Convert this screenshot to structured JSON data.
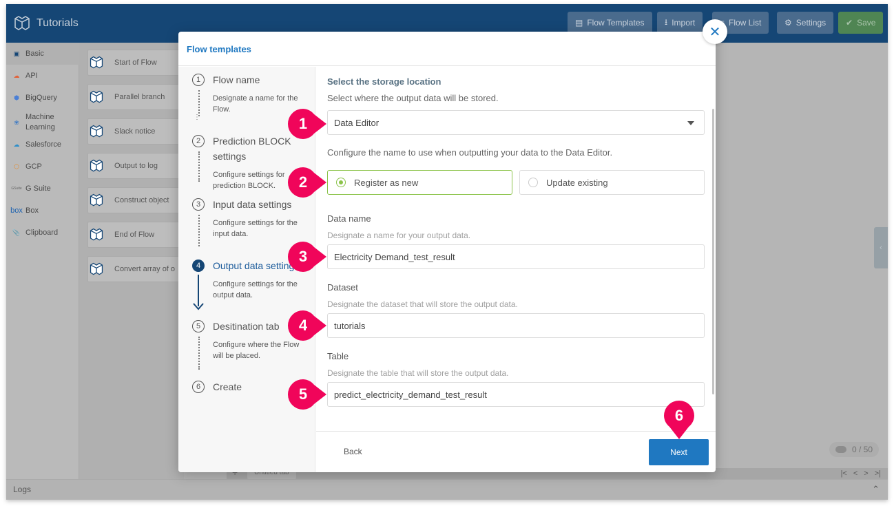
{
  "app": {
    "title": "Tutorials",
    "toolbar": [
      {
        "label": "Flow Templates",
        "icon": "list-icon"
      },
      {
        "label": "Import",
        "icon": "upload-icon"
      },
      {
        "label": "Flow List",
        "icon": "menu-icon"
      },
      {
        "label": "Settings",
        "icon": "gear-icon"
      },
      {
        "label": "Save",
        "icon": "check-circle-icon"
      }
    ]
  },
  "categories": [
    {
      "label": "Basic",
      "icon": "basic-block-icon",
      "active": true
    },
    {
      "label": "API",
      "icon": "api-cloud-icon"
    },
    {
      "label": "BigQuery",
      "icon": "bigquery-icon"
    },
    {
      "label": "Machine Learning",
      "icon": "brain-icon"
    },
    {
      "label": "Salesforce",
      "icon": "salesforce-cloud-icon"
    },
    {
      "label": "GCP",
      "icon": "gcp-icon"
    },
    {
      "label": "G Suite",
      "icon": "gsuite-icon",
      "icon_text": "G Suite"
    },
    {
      "label": "Box",
      "icon": "box-icon",
      "icon_text": "box"
    },
    {
      "label": "Clipboard",
      "icon": "paperclip-icon"
    }
  ],
  "blocks": [
    {
      "label": "Start of Flow"
    },
    {
      "label": "Parallel branch"
    },
    {
      "label": "Slack notice"
    },
    {
      "label": "Output to log"
    },
    {
      "label": "Construct object"
    },
    {
      "label": "End of Flow"
    },
    {
      "label": "Convert array of o"
    }
  ],
  "canvas": {
    "counter": "0 / 50",
    "tab_label": "Untitled tab",
    "pager": [
      "|<",
      "<",
      ">",
      ">|"
    ]
  },
  "logs": {
    "label": "Logs"
  },
  "modal": {
    "title": "Flow templates",
    "steps": [
      {
        "num": "1",
        "title": "Flow name",
        "desc": "Designate a name for the Flow."
      },
      {
        "num": "2",
        "title": "Prediction BLOCK settings",
        "desc": "Configure settings for prediction BLOCK."
      },
      {
        "num": "3",
        "title": "Input data settings",
        "desc": "Configure settings for the input data."
      },
      {
        "num": "4",
        "title": "Output data settings",
        "desc": "Configure settings for the output data.",
        "active": true
      },
      {
        "num": "5",
        "title": "Desitination tab",
        "desc": "Configure where the Flow will be placed."
      },
      {
        "num": "6",
        "title": "Create",
        "desc": ""
      }
    ],
    "content": {
      "section_title": "Select the storage location",
      "section_desc": "Select where the output data will be stored.",
      "storage_select": "Data Editor",
      "name_desc": "Configure the name to use when outputting your data to the Data Editor.",
      "radio_options": [
        {
          "label": "Register as new",
          "selected": true
        },
        {
          "label": "Update existing",
          "selected": false
        }
      ],
      "data_name": {
        "label": "Data name",
        "help": "Designate a name for your output data.",
        "value": "Electricity Demand_test_result"
      },
      "dataset": {
        "label": "Dataset",
        "help": "Designate the dataset that will store the output data.",
        "value": "tutorials"
      },
      "table": {
        "label": "Table",
        "help": "Designate the table that will store the output data.",
        "value": "predict_electricity_demand_test_result"
      }
    },
    "footer": {
      "back": "Back",
      "next": "Next"
    }
  },
  "annotations": [
    "1",
    "2",
    "3",
    "4",
    "5",
    "6"
  ],
  "colors": {
    "header": "#154675",
    "accent": "#1f78c1",
    "marker": "#f0055a",
    "radio_selected": "#8bc34a"
  }
}
